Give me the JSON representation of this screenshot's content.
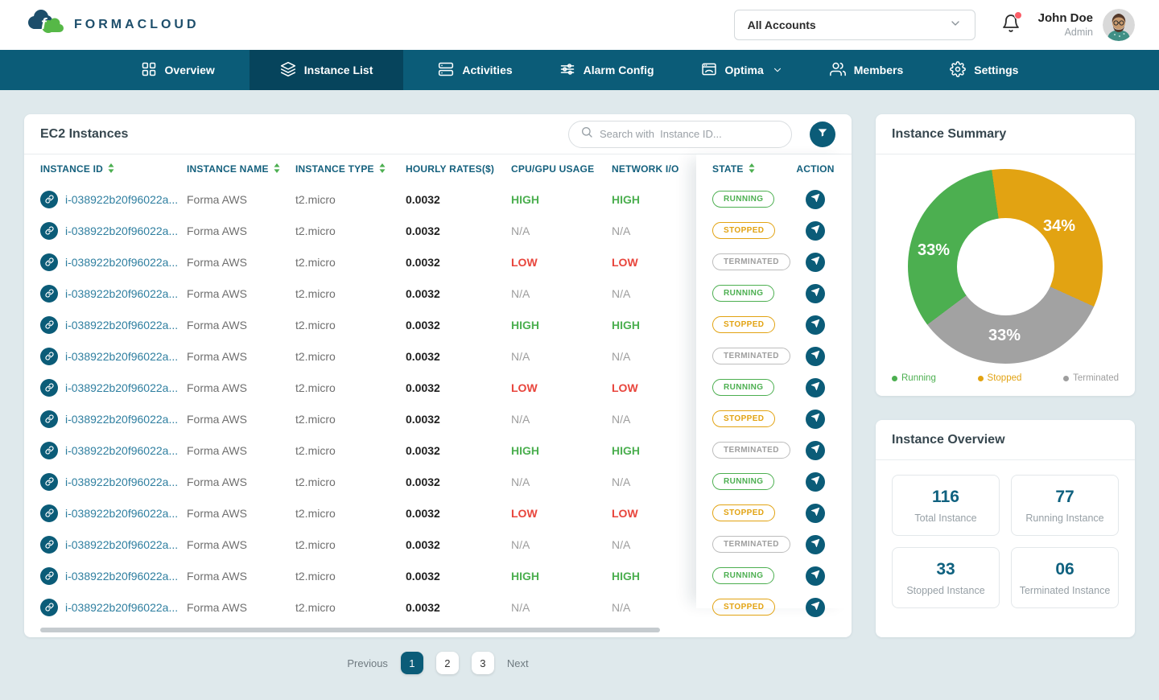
{
  "brand": {
    "name": "FORMACLOUD"
  },
  "header": {
    "account_selector": {
      "value": "All Accounts"
    },
    "user": {
      "name": "John Doe",
      "role": "Admin"
    }
  },
  "nav": {
    "items": [
      {
        "label": "Overview",
        "icon": "grid-icon",
        "active": false,
        "dropdown": false
      },
      {
        "label": "Instance List",
        "icon": "layers-icon",
        "active": true,
        "dropdown": false
      },
      {
        "label": "Activities",
        "icon": "server-icon",
        "active": false,
        "dropdown": false
      },
      {
        "label": "Alarm Config",
        "icon": "sliders-icon",
        "active": false,
        "dropdown": false
      },
      {
        "label": "Optima",
        "icon": "window-icon",
        "active": false,
        "dropdown": true
      },
      {
        "label": "Members",
        "icon": "users-icon",
        "active": false,
        "dropdown": false
      },
      {
        "label": "Settings",
        "icon": "gear-icon",
        "active": false,
        "dropdown": false
      }
    ]
  },
  "instances_panel": {
    "title": "EC2 Instances",
    "search_placeholder": "Search with  Instance ID...",
    "columns": [
      {
        "label": "INSTANCE ID",
        "sortable": true
      },
      {
        "label": "INSTANCE NAME",
        "sortable": true
      },
      {
        "label": "INSTANCE TYPE",
        "sortable": true
      },
      {
        "label": "HOURLY RATES($)",
        "sortable": false
      },
      {
        "label": "CPU/GPU USAGE",
        "sortable": false
      },
      {
        "label": "NETWORK I/O",
        "sortable": false
      },
      {
        "label": "STATE",
        "sortable": true
      },
      {
        "label": "ACTION",
        "sortable": false
      }
    ],
    "rows": [
      {
        "id": "i-038922b20f96022a...",
        "name": "Forma AWS",
        "type": "t2.micro",
        "rate": "0.0032",
        "cpu": "HIGH",
        "net": "HIGH",
        "state": "RUNNING"
      },
      {
        "id": "i-038922b20f96022a...",
        "name": "Forma AWS",
        "type": "t2.micro",
        "rate": "0.0032",
        "cpu": "N/A",
        "net": "N/A",
        "state": "STOPPED"
      },
      {
        "id": "i-038922b20f96022a...",
        "name": "Forma AWS",
        "type": "t2.micro",
        "rate": "0.0032",
        "cpu": "LOW",
        "net": "LOW",
        "state": "TERMINATED"
      },
      {
        "id": "i-038922b20f96022a...",
        "name": "Forma AWS",
        "type": "t2.micro",
        "rate": "0.0032",
        "cpu": "N/A",
        "net": "N/A",
        "state": "RUNNING"
      },
      {
        "id": "i-038922b20f96022a...",
        "name": "Forma AWS",
        "type": "t2.micro",
        "rate": "0.0032",
        "cpu": "HIGH",
        "net": "HIGH",
        "state": "STOPPED"
      },
      {
        "id": "i-038922b20f96022a...",
        "name": "Forma AWS",
        "type": "t2.micro",
        "rate": "0.0032",
        "cpu": "N/A",
        "net": "N/A",
        "state": "TERMINATED"
      },
      {
        "id": "i-038922b20f96022a...",
        "name": "Forma AWS",
        "type": "t2.micro",
        "rate": "0.0032",
        "cpu": "LOW",
        "net": "LOW",
        "state": "RUNNING"
      },
      {
        "id": "i-038922b20f96022a...",
        "name": "Forma AWS",
        "type": "t2.micro",
        "rate": "0.0032",
        "cpu": "N/A",
        "net": "N/A",
        "state": "STOPPED"
      },
      {
        "id": "i-038922b20f96022a...",
        "name": "Forma AWS",
        "type": "t2.micro",
        "rate": "0.0032",
        "cpu": "HIGH",
        "net": "HIGH",
        "state": "TERMINATED"
      },
      {
        "id": "i-038922b20f96022a...",
        "name": "Forma AWS",
        "type": "t2.micro",
        "rate": "0.0032",
        "cpu": "N/A",
        "net": "N/A",
        "state": "RUNNING"
      },
      {
        "id": "i-038922b20f96022a...",
        "name": "Forma AWS",
        "type": "t2.micro",
        "rate": "0.0032",
        "cpu": "LOW",
        "net": "LOW",
        "state": "STOPPED"
      },
      {
        "id": "i-038922b20f96022a...",
        "name": "Forma AWS",
        "type": "t2.micro",
        "rate": "0.0032",
        "cpu": "N/A",
        "net": "N/A",
        "state": "TERMINATED"
      },
      {
        "id": "i-038922b20f96022a...",
        "name": "Forma AWS",
        "type": "t2.micro",
        "rate": "0.0032",
        "cpu": "HIGH",
        "net": "HIGH",
        "state": "RUNNING"
      },
      {
        "id": "i-038922b20f96022a...",
        "name": "Forma AWS",
        "type": "t2.micro",
        "rate": "0.0032",
        "cpu": "N/A",
        "net": "N/A",
        "state": "STOPPED"
      }
    ],
    "pagination": {
      "previous": "Previous",
      "pages": [
        "1",
        "2",
        "3"
      ],
      "active_page": "1",
      "next": "Next"
    }
  },
  "summary_panel": {
    "title": "Instance Summary",
    "chart_data": {
      "type": "pie",
      "title": "Instance Summary",
      "donut_hole_ratio": 0.5,
      "start_angle_deg": -8,
      "slices": [
        {
          "label": "Stopped",
          "value": 34,
          "pct_label": "34%",
          "color": "#E2A312"
        },
        {
          "label": "Terminated",
          "value": 33,
          "pct_label": "33%",
          "color": "#A2A2A2"
        },
        {
          "label": "Running",
          "value": 33,
          "pct_label": "33%",
          "color": "#4CAF50"
        }
      ],
      "legend": [
        {
          "label": "Running",
          "color": "#4CAF50"
        },
        {
          "label": "Stopped",
          "color": "#E2A312"
        },
        {
          "label": "Terminated",
          "color": "#9E9E9E"
        }
      ],
      "legend_position": "bottom"
    }
  },
  "overview_panel": {
    "title": "Instance Overview",
    "stats": [
      {
        "value": "116",
        "label": "Total Instance"
      },
      {
        "value": "77",
        "label": "Running Instance"
      },
      {
        "value": "33",
        "label": "Stopped Instance"
      },
      {
        "value": "06",
        "label": "Terminated Instance"
      }
    ]
  },
  "colors": {
    "navbar": "#0B5C78",
    "navbar_active": "#06445C",
    "accent_teal": "#0B5C78",
    "link_text": "#2F7FA0",
    "green": "#4CAF50",
    "amber": "#E2A312",
    "red": "#E8453C",
    "gray": "#9E9E9E",
    "page_background": "#DFE9EC"
  }
}
